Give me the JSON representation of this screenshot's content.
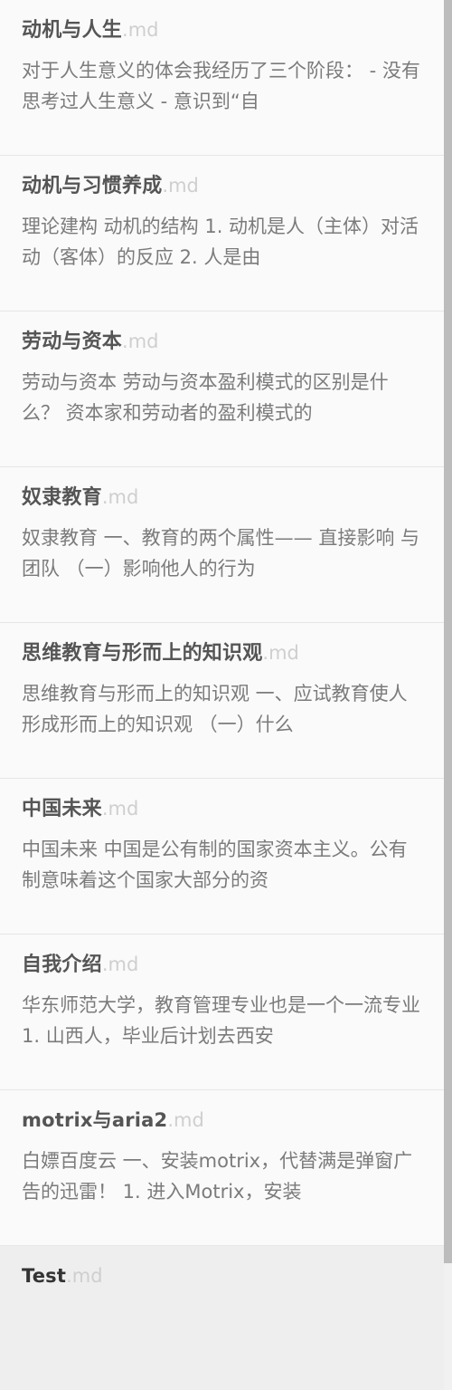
{
  "files": [
    {
      "title": "动机与人生",
      "ext": ".md",
      "excerpt": "对于人生意义的体会我经历了三个阶段： - 没有思考过人生意义 - 意识到“自"
    },
    {
      "title": "动机与习惯养成",
      "ext": ".md",
      "excerpt": "理论建构 动机的结构 1. 动机是人（主体）对活动（客体）的反应 2. 人是由"
    },
    {
      "title": "劳动与资本",
      "ext": ".md",
      "excerpt": "劳动与资本 劳动与资本盈利模式的区别是什么？ 资本家和劳动者的盈利模式的"
    },
    {
      "title": "奴隶教育",
      "ext": ".md",
      "excerpt": "奴隶教育 一、教育的两个属性—— 直接影响 与 团队 （一）影响他人的行为"
    },
    {
      "title": "思维教育与形而上的知识观",
      "ext": ".md",
      "excerpt": "思维教育与形而上的知识观 一、应试教育使人形成形而上的知识观 （一）什么"
    },
    {
      "title": "中国未来",
      "ext": ".md",
      "excerpt": "中国未来 中国是公有制的国家资本主义。公有制意味着这个国家大部分的资"
    },
    {
      "title": "自我介绍",
      "ext": ".md",
      "excerpt": "华东师范大学，教育管理专业也是一个一流专业 1. 山西人，毕业后计划去西安"
    },
    {
      "title": "motrix与aria2",
      "ext": ".md",
      "excerpt": "白嫖百度云 一、安装motrix，代替满是弹窗广告的迅雷！ 1. 进入Motrix，安装"
    },
    {
      "title": "Test",
      "ext": ".md",
      "excerpt": ""
    }
  ]
}
